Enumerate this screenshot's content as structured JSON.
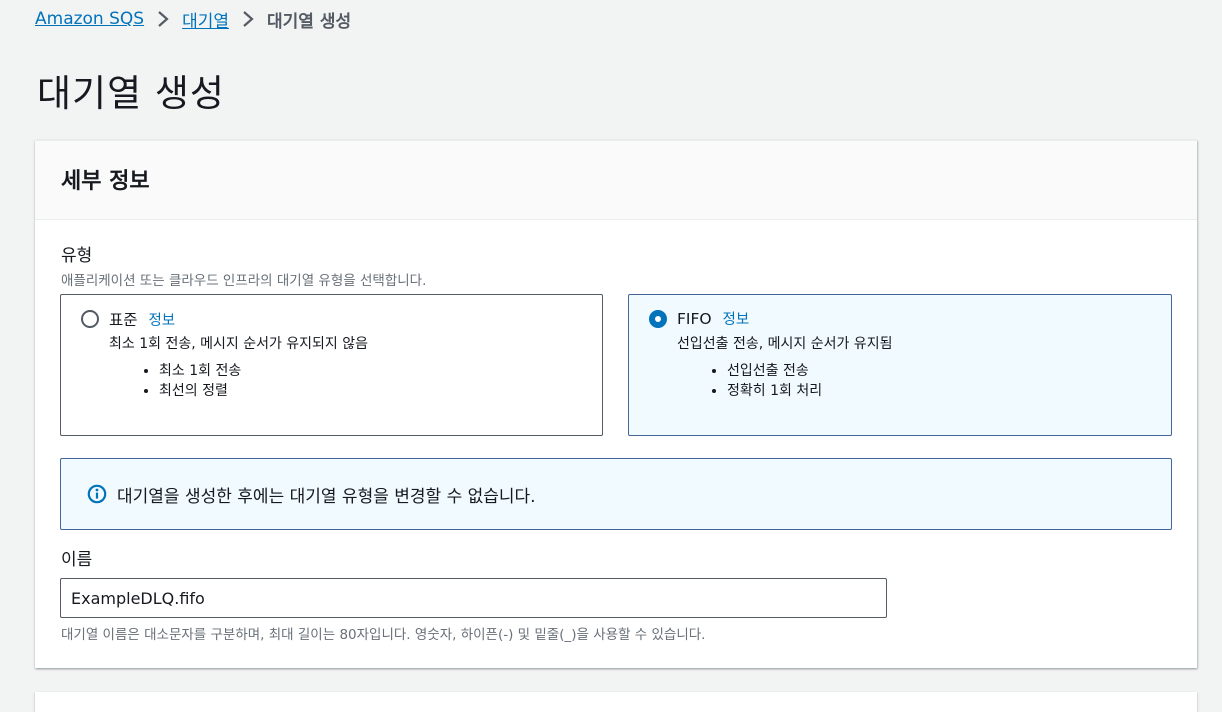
{
  "breadcrumb": {
    "root": "Amazon SQS",
    "parent": "대기열",
    "current": "대기열 생성"
  },
  "page_title": "대기열 생성",
  "details_panel": {
    "title": "세부 정보",
    "type_field": {
      "label": "유형",
      "description": "애플리케이션 또는 클라우드 인프라의 대기열 유형을 선택합니다.",
      "options": [
        {
          "title": "표준",
          "info_link": "정보",
          "selected": false,
          "description": "최소 1회 전송, 메시지 순서가 유지되지 않음",
          "bullets": [
            "최소 1회 전송",
            "최선의 정렬"
          ]
        },
        {
          "title": "FIFO",
          "info_link": "정보",
          "selected": true,
          "description": "선입선출 전송, 메시지 순서가 유지됨",
          "bullets": [
            "선입선출 전송",
            "정확히 1회 처리"
          ]
        }
      ]
    },
    "alert": {
      "icon": "info-icon",
      "text": "대기열을 생성한 후에는 대기열 유형을 변경할 수 없습니다."
    },
    "name_field": {
      "label": "이름",
      "value": "ExampleDLQ.fifo",
      "constraint": "대기열 이름은 대소문자를 구분하며, 최대 길이는 80자입니다. 영숫자, 하이픈(-) 및 밑줄(_)을 사용할 수 있습니다."
    }
  },
  "colors": {
    "link": "#0073bb",
    "selected_border": "#44659a",
    "selected_bg": "#f1faff",
    "page_bg": "#f2f3f3"
  }
}
